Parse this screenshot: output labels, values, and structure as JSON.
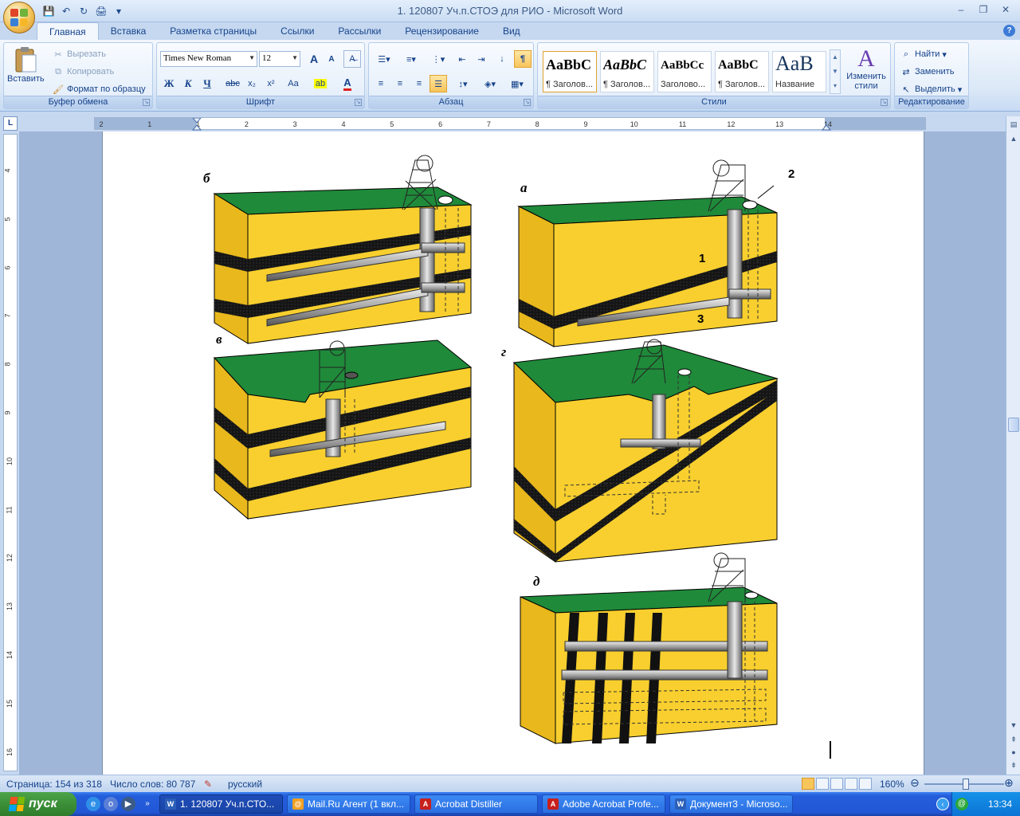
{
  "window": {
    "title": "1. 120807 Уч.п.СТОЭ для РИО - Microsoft Word",
    "minimize": "–",
    "restore": "❐",
    "close": "✕"
  },
  "qat": {
    "save": "💾",
    "undo": "↶",
    "redo": "↻",
    "print": "🖨",
    "more": "▾"
  },
  "tabs": [
    "Главная",
    "Вставка",
    "Разметка страницы",
    "Ссылки",
    "Рассылки",
    "Рецензирование",
    "Вид"
  ],
  "ribbon": {
    "clipboard": {
      "label": "Буфер обмена",
      "paste": "Вставить",
      "cut": "Вырезать",
      "copy": "Копировать",
      "format_painter": "Формат по образцу"
    },
    "font": {
      "label": "Шрифт",
      "family": "Times New Roman",
      "size": "12",
      "bold": "Ж",
      "italic": "К",
      "underline": "Ч",
      "strike": "abc",
      "sub": "x₂",
      "sup": "x²",
      "case": "Aa",
      "grow": "A",
      "shrink": "A"
    },
    "paragraph": {
      "label": "Абзац"
    },
    "styles": {
      "label": "Стили",
      "items": [
        {
          "sample": "AaBbC",
          "name": "¶ Заголов..."
        },
        {
          "sample": "AaBbC",
          "name": "¶ Заголов..."
        },
        {
          "sample": "AaBbCc",
          "name": "Заголово..."
        },
        {
          "sample": "AaBbC",
          "name": "¶ Заголов..."
        },
        {
          "sample": "AaB",
          "name": "Название"
        }
      ],
      "change": "Изменить стили"
    },
    "editing": {
      "label": "Редактирование",
      "find": "Найти",
      "replace": "Заменить",
      "select": "Выделить"
    }
  },
  "ruler": {
    "h_ticks": [
      "2",
      "1",
      "1",
      "2",
      "3",
      "4",
      "5",
      "6",
      "7",
      "8",
      "9",
      "10",
      "11",
      "12",
      "13",
      "14"
    ],
    "v_ticks": [
      "4",
      "5",
      "6",
      "7",
      "8",
      "9",
      "10",
      "11",
      "12",
      "13",
      "14",
      "15",
      "16"
    ]
  },
  "figure": {
    "panel_labels": [
      "б",
      "а",
      "в",
      "г",
      "д"
    ],
    "callouts": [
      "1",
      "2",
      "3"
    ],
    "colors": {
      "surface": "#1f8a3a",
      "earth": "#f8cf2e",
      "earth_side": "#e8b81c",
      "seam": "#111111",
      "shaft": "#c8c8c8"
    }
  },
  "status": {
    "page": "Страница: 154 из 318",
    "words": "Число слов: 80 787",
    "lang": "русский",
    "zoom": "160%"
  },
  "taskbar": {
    "start": "пуск",
    "tasks": [
      "1. 120807 Уч.п.СТО...",
      "Mail.Ru Агент (1 вкл...",
      "Acrobat Distiller",
      "Adobe Acrobat Profe...",
      "Документ3 - Microso..."
    ],
    "clock": "13:34"
  }
}
